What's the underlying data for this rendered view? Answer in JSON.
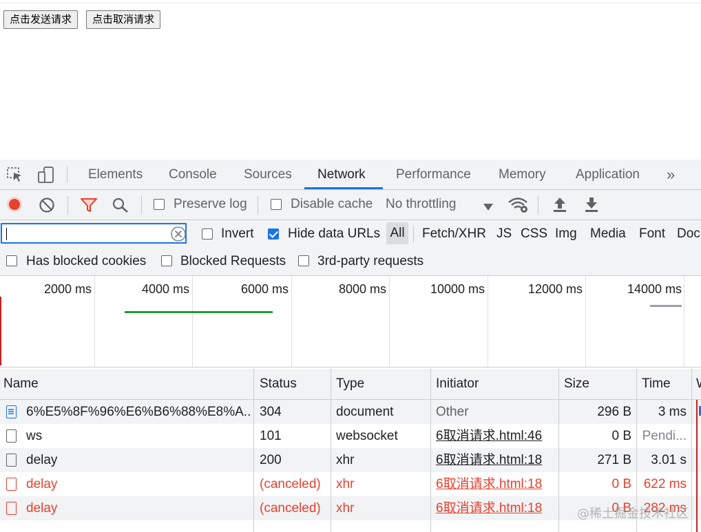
{
  "page": {
    "buttons": [
      "点击发送请求",
      "点击取消请求"
    ]
  },
  "devtools": {
    "tabs": [
      "Elements",
      "Console",
      "Sources",
      "Network",
      "Performance",
      "Memory",
      "Application"
    ],
    "active_tab": "Network",
    "toolbar": {
      "preserve_log": "Preserve log",
      "disable_cache": "Disable cache",
      "throttling": "No throttling"
    },
    "filter": {
      "value": "",
      "invert": "Invert",
      "hide_data_urls": "Hide data URLs",
      "types": [
        "All",
        "Fetch/XHR",
        "JS",
        "CSS",
        "Img",
        "Media",
        "Font",
        "Doc"
      ],
      "has_blocked_cookies": "Has blocked cookies",
      "blocked_requests": "Blocked Requests",
      "third_party": "3rd-party requests"
    },
    "timeline_ticks": [
      "2000 ms",
      "4000 ms",
      "6000 ms",
      "8000 ms",
      "10000 ms",
      "12000 ms",
      "14000 ms"
    ],
    "columns": [
      "Name",
      "Status",
      "Type",
      "Initiator",
      "Size",
      "Time",
      "W"
    ],
    "rows": [
      {
        "name": "6%E5%8F%96%E6%B6%88%E8%A...",
        "status": "304",
        "type": "document",
        "initiator": "Other",
        "size": "296 B",
        "time": "3 ms",
        "kind": "doc",
        "error": false
      },
      {
        "name": "ws",
        "status": "101",
        "type": "websocket",
        "initiator": "6取消请求.html:46",
        "size": "0 B",
        "time": "Pendi...",
        "kind": "file",
        "error": false
      },
      {
        "name": "delay",
        "status": "200",
        "type": "xhr",
        "initiator": "6取消请求.html:18",
        "size": "271 B",
        "time": "3.01 s",
        "kind": "file",
        "error": false
      },
      {
        "name": "delay",
        "status": "(canceled)",
        "type": "xhr",
        "initiator": "6取消请求.html:18",
        "size": "0 B",
        "time": "622 ms",
        "kind": "file",
        "error": true
      },
      {
        "name": "delay",
        "status": "(canceled)",
        "type": "xhr",
        "initiator": "6取消请求.html:18",
        "size": "0 B",
        "time": "282 ms",
        "kind": "file",
        "error": true
      }
    ],
    "watermark": "@稀土掘金技术社区"
  }
}
